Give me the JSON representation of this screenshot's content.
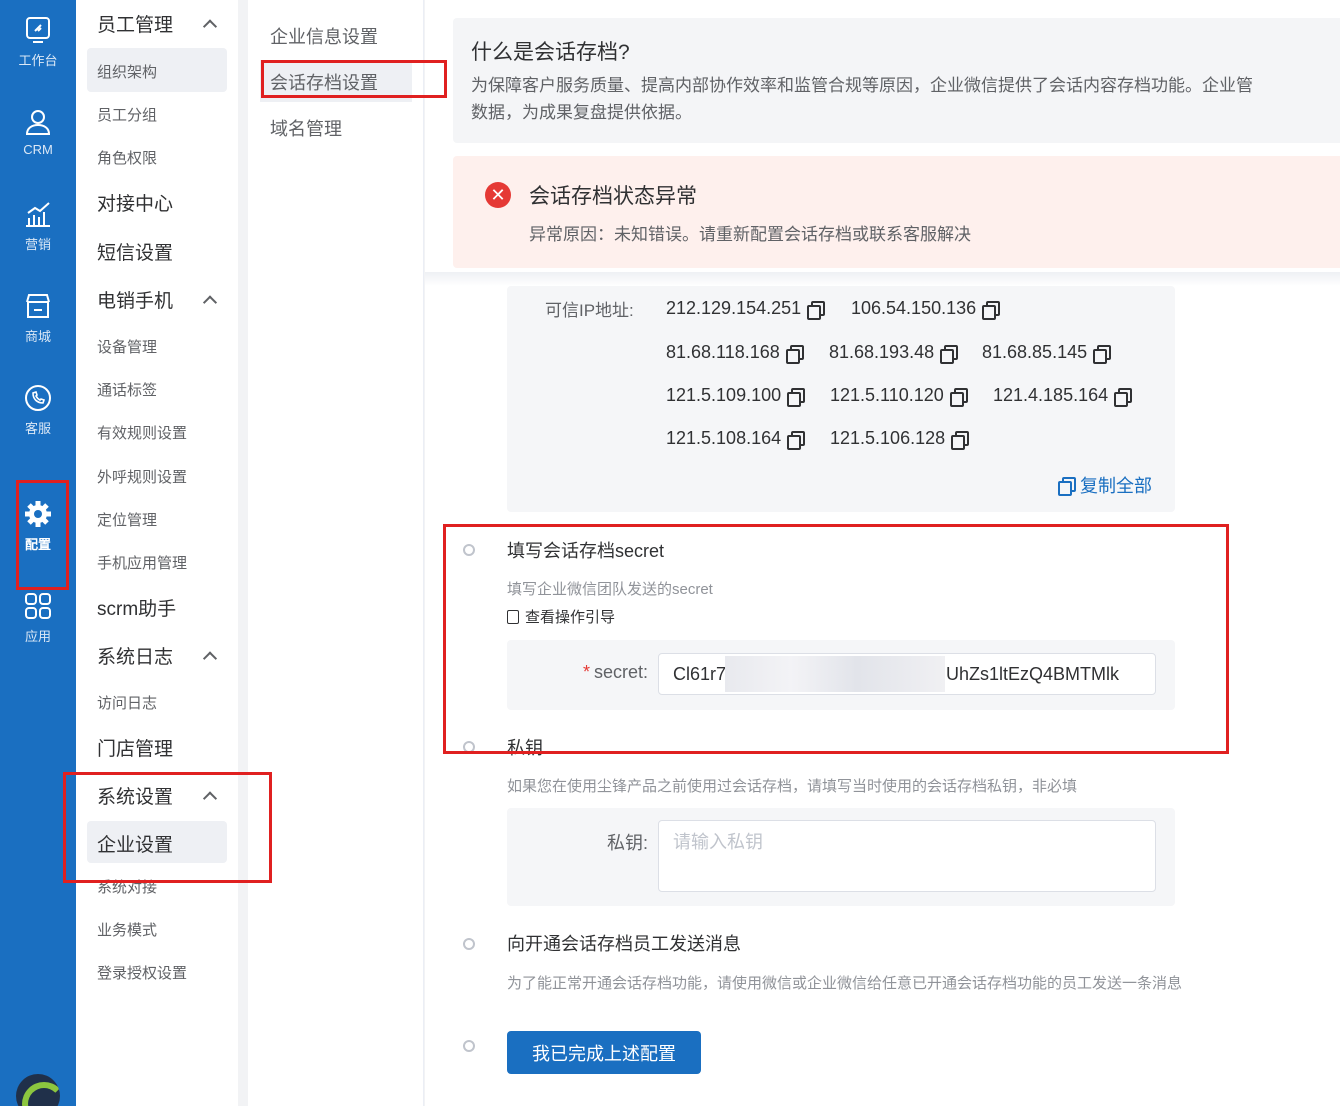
{
  "rail": [
    {
      "label": "工作台",
      "icon": "workbench-icon"
    },
    {
      "label": "CRM",
      "icon": "user-icon"
    },
    {
      "label": "营销",
      "icon": "chart-icon"
    },
    {
      "label": "商城",
      "icon": "store-icon"
    },
    {
      "label": "客服",
      "icon": "phone-icon"
    },
    {
      "label": "配置",
      "icon": "gear-icon",
      "active": true
    },
    {
      "label": "应用",
      "icon": "apps-icon"
    }
  ],
  "menu": {
    "g_staff": "员工管理",
    "org": "组织架构",
    "group": "员工分组",
    "role": "角色权限",
    "g_dock": "对接中心",
    "g_sms": "短信设置",
    "g_phone": "电销手机",
    "device": "设备管理",
    "tag": "通话标签",
    "rule": "有效规则设置",
    "call": "外呼规则设置",
    "loc": "定位管理",
    "app": "手机应用管理",
    "g_scrm": "scrm助手",
    "g_log": "系统日志",
    "visit": "访问日志",
    "g_store": "门店管理",
    "g_sys": "系统设置",
    "company": "企业设置",
    "dock": "系统对接",
    "biz": "业务模式",
    "auth": "登录授权设置"
  },
  "sub": {
    "info": "企业信息设置",
    "archive": "会话存档设置",
    "domain": "域名管理"
  },
  "info": {
    "title": "什么是会话存档?",
    "desc1": "为保障客户服务质量、提高内部协作效率和监管合规等原因，企业微信提供了会话内容存档功能。企业管",
    "desc2": "数据，为成果复盘提供依据。"
  },
  "error": {
    "title": "会话存档状态异常",
    "desc": "异常原因：未知错误。请重新配置会话存档或联系客服解决"
  },
  "ip": {
    "label": "可信IP地址:",
    "list": [
      "212.129.154.251",
      "106.54.150.136",
      "81.68.118.168",
      "81.68.193.48",
      "81.68.85.145",
      "121.5.109.100",
      "121.5.110.120",
      "121.4.185.164",
      "121.5.108.164",
      "121.5.106.128"
    ],
    "copy_all": "复制全部"
  },
  "step_secret": {
    "title": "填写会话存档secret",
    "desc": "填写企业微信团队发送的secret",
    "guide": "查看操作引导",
    "label": "secret:",
    "value_start": "Cl61r7",
    "value_end": "UhZs1ltEzQ4BMTMlk"
  },
  "step_key": {
    "title": "私钥",
    "desc": "如果您在使用尘锋产品之前使用过会话存档，请填写当时使用的会话存档私钥，非必填",
    "label": "私钥:",
    "placeholder": "请输入私钥"
  },
  "step_msg": {
    "title": "向开通会话存档员工发送消息",
    "desc": "为了能正常开通会话存档功能，请使用微信或企业微信给任意已开通会话存档功能的员工发送一条消息"
  },
  "submit": "我已完成上述配置",
  "colors": {
    "primary": "#1a6fc1",
    "error": "#e53935",
    "highlight": "#e02020"
  }
}
